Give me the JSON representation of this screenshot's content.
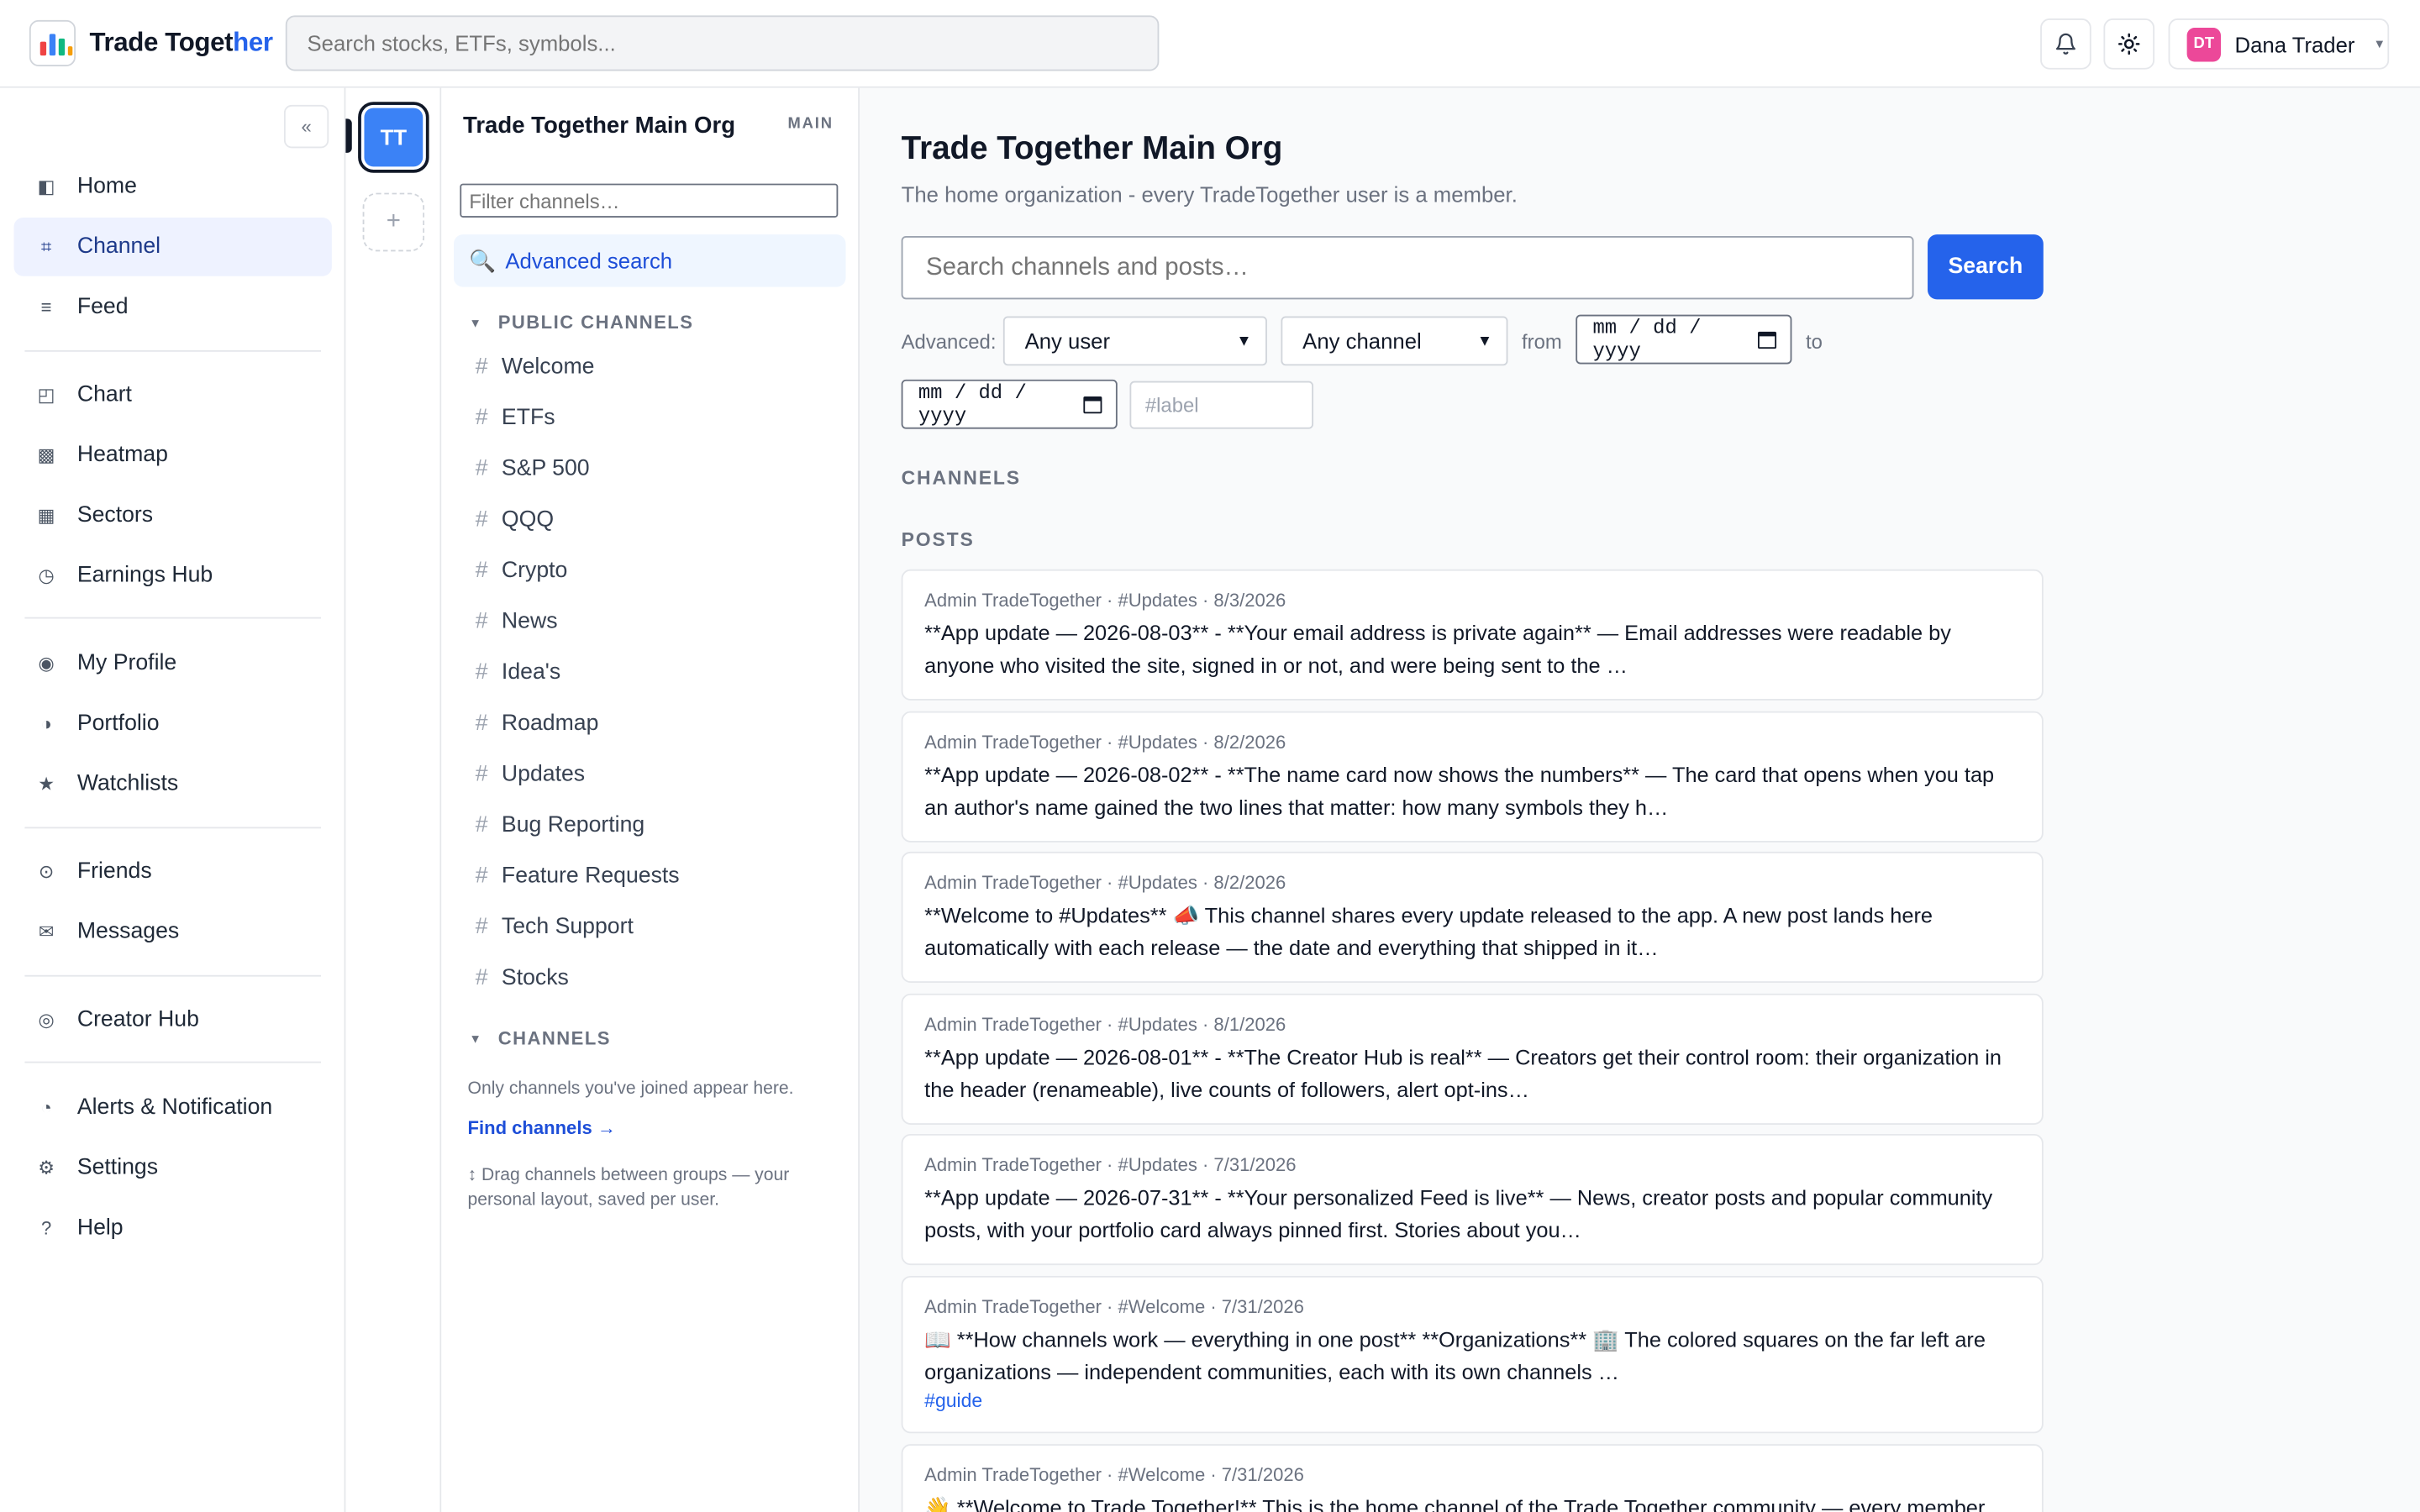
{
  "header": {
    "brand_part1": "Trade Toget",
    "brand_part2": "her",
    "search_placeholder": "Search stocks, ETFs, symbols...",
    "user_initials": "DT",
    "user_name": "Dana Trader"
  },
  "sidebar": {
    "collapse_label": "«",
    "items": [
      {
        "label": "Home",
        "icon": "◧"
      },
      {
        "label": "Channel",
        "icon": "⌗"
      },
      {
        "label": "Feed",
        "icon": "≡"
      },
      {
        "label": "Chart",
        "icon": "◰"
      },
      {
        "label": "Heatmap",
        "icon": "▩"
      },
      {
        "label": "Sectors",
        "icon": "▦"
      },
      {
        "label": "Earnings Hub",
        "icon": "◷"
      },
      {
        "label": "My Profile",
        "icon": "◉"
      },
      {
        "label": "Portfolio",
        "icon": "◑"
      },
      {
        "label": "Watchlists",
        "icon": "★"
      },
      {
        "label": "Friends",
        "icon": "⊙"
      },
      {
        "label": "Messages",
        "icon": "✉"
      },
      {
        "label": "Creator Hub",
        "icon": "◎"
      },
      {
        "label": "Alerts & Notification",
        "icon": "◔"
      },
      {
        "label": "Settings",
        "icon": "⚙"
      },
      {
        "label": "Help",
        "icon": "?"
      }
    ]
  },
  "rail": {
    "org_initials": "TT",
    "add_label": "+"
  },
  "channels_panel": {
    "org_name": "Trade Together Main Org",
    "badge": "MAIN",
    "filter_placeholder": "Filter channels…",
    "advanced_search": "Advanced search",
    "public_header": "PUBLIC CHANNELS",
    "public_channels": [
      "Welcome",
      "ETFs",
      "S&P 500",
      "QQQ",
      "Crypto",
      "News",
      "Idea's",
      "Roadmap",
      "Updates",
      "Bug Reporting",
      "Feature Requests",
      "Tech Support",
      "Stocks"
    ],
    "channels_header": "CHANNELS",
    "joined_note": "Only channels you've joined appear here.",
    "find_channels": "Find channels →",
    "drag_note": "↕ Drag channels between groups — your personal layout, saved per user."
  },
  "main": {
    "title": "Trade Together Main Org",
    "subtitle": "The home organization - every TradeTogether user is a member.",
    "search_placeholder": "Search channels and posts…",
    "search_button": "Search",
    "advanced_label": "Advanced:",
    "user_select": "Any user",
    "channel_select": "Any channel",
    "from_label": "from",
    "to_label": "to",
    "date_placeholder": "mm / dd / yyyy",
    "label_placeholder": "#label",
    "channels_header": "CHANNELS",
    "posts_header": "POSTS",
    "posts": [
      {
        "meta": "Admin TradeTogether · #Updates · 8/3/2026",
        "body": "**App update — 2026-08-03** - **Your email address is private again** — Email addresses were readable by anyone who visited the site, signed in or not, and were being sent to the …",
        "tag": ""
      },
      {
        "meta": "Admin TradeTogether · #Updates · 8/2/2026",
        "body": "**App update — 2026-08-02** - **The name card now shows the numbers** — The card that opens when you tap an author's name gained the two lines that matter: how many symbols they h…",
        "tag": ""
      },
      {
        "meta": "Admin TradeTogether · #Updates · 8/2/2026",
        "body": "**Welcome to #Updates** 📣 This channel shares every update released to the app. A new post lands here automatically with each release — the date and everything that shipped in it…",
        "tag": ""
      },
      {
        "meta": "Admin TradeTogether · #Updates · 8/1/2026",
        "body": "**App update — 2026-08-01** - **The Creator Hub is real** — Creators get their control room: their organization in the header (renameable), live counts of followers, alert opt-ins…",
        "tag": ""
      },
      {
        "meta": "Admin TradeTogether · #Updates · 7/31/2026",
        "body": "**App update — 2026-07-31** - **Your personalized Feed is live** — News, creator posts and popular community posts, with your portfolio card always pinned first. Stories about you…",
        "tag": ""
      },
      {
        "meta": "Admin TradeTogether · #Welcome · 7/31/2026",
        "body": "📖 **How channels work — everything in one post** **Organizations** 🏢 The colored squares on the far left are organizations — independent communities, each with its own channels …",
        "tag": "#guide"
      },
      {
        "meta": "Admin TradeTogether · #Welcome · 7/31/2026",
        "body": "👋 **Welcome to Trade Together!** This is the home channel of the Trade Together community — every member lands",
        "tag": ""
      }
    ]
  },
  "colors": {
    "accent": "#2563eb",
    "org_tile": "#3b82f6",
    "avatar": "#ec4899"
  }
}
